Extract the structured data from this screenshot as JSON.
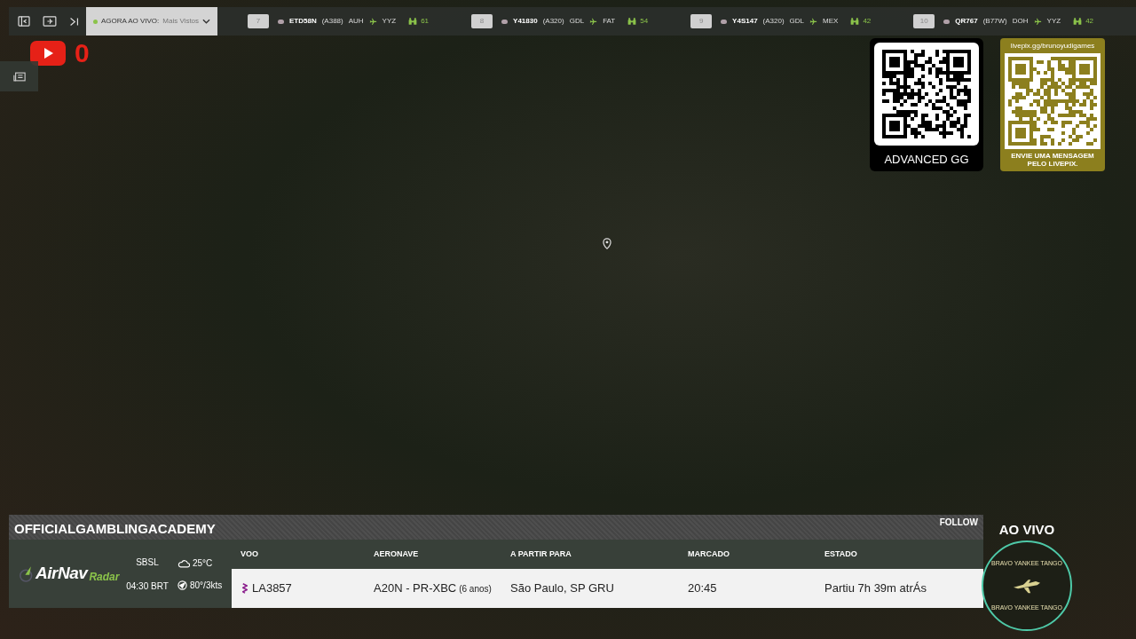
{
  "live_selector": {
    "label": "AGORA AO VIVO:",
    "value": "Mais Vistos"
  },
  "ticker": [
    {
      "rank": "7",
      "callsign": "ETD58N",
      "aircraft": "(A388)",
      "from": "AUH",
      "to": "YYZ",
      "viewers": "61"
    },
    {
      "rank": "8",
      "callsign": "Y41830",
      "aircraft": "(A320)",
      "from": "GDL",
      "to": "FAT",
      "viewers": "54"
    },
    {
      "rank": "9",
      "callsign": "Y4S147",
      "aircraft": "(A320)",
      "from": "GDL",
      "to": "MEX",
      "viewers": "42"
    },
    {
      "rank": "10",
      "callsign": "QR767",
      "aircraft": "(B77W)",
      "from": "DOH",
      "to": "YYZ",
      "viewers": "42"
    }
  ],
  "youtube": {
    "count": "0"
  },
  "qr_cards": [
    {
      "kind": "plain",
      "caption": "ADVANCED GG"
    },
    {
      "kind": "livepix",
      "header": "livepix.gg/brunoyudigames",
      "caption": "ENVIE UMA MENSAGEM PELO LIVEPIX."
    }
  ],
  "panel": {
    "channel": "OFFICIALGAMBLINGACADEMY",
    "follow": "FOLLOW",
    "logo": {
      "main": "AirNav",
      "sub": "Radar"
    },
    "airport": "SBSL",
    "time": "04:30 BRT",
    "temperature": "25°C",
    "wind": "80°/3kts",
    "columns": [
      "VOO",
      "AERONAVE",
      "A PARTIR PARA",
      "MARCADO",
      "ESTADO"
    ],
    "row": {
      "flight": "LA3857",
      "aircraft": "A20N - PR-XBC",
      "age": "(6 anos)",
      "destination": "São Paulo, SP GRU",
      "scheduled": "20:45",
      "status": "Partiu 7h 39m atrÁs"
    }
  },
  "live_badge": {
    "label": "AO VIVO",
    "emblem_top": "BRAVO YANKEE TANGO",
    "emblem_bottom": "BRAVO YANKEE TANGO"
  }
}
